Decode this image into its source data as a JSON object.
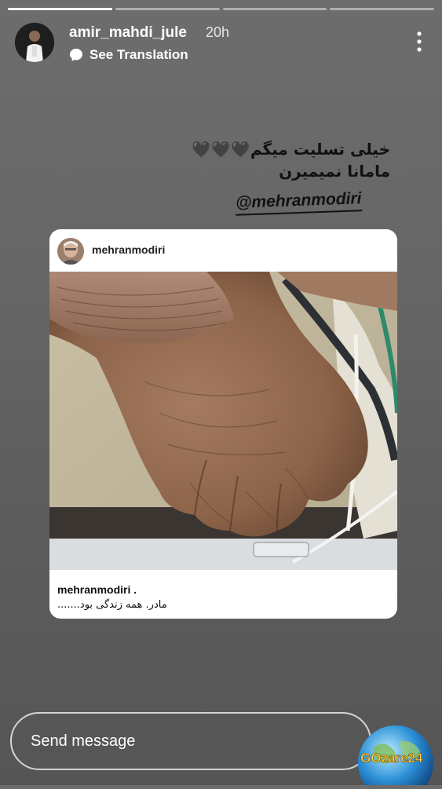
{
  "story": {
    "segments": 4,
    "active_segment": 1,
    "username": "amir_mahdi_jule",
    "time": "20h",
    "see_translation": "See Translation",
    "caption_line1_hearts": "🖤🖤🖤",
    "caption_line1": "خیلی تسلیت میگم",
    "caption_line2": "مامانا نمیمیرن",
    "mention": "@mehranmodiri"
  },
  "shared_post": {
    "username": "mehranmodiri",
    "footer_username": "mehranmodiri .",
    "caption": "مادر.  همه زندگی بود......."
  },
  "composer": {
    "placeholder": "Send message"
  },
  "watermark": {
    "text": "GOzare24"
  }
}
